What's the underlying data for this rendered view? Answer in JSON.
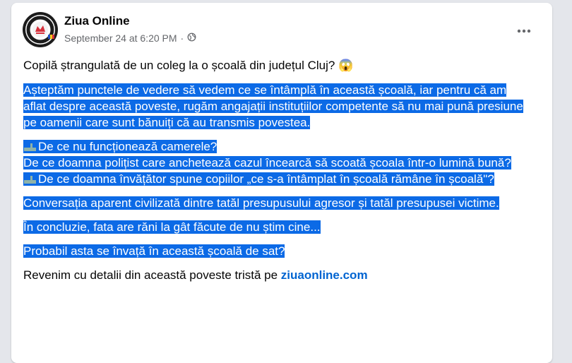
{
  "post": {
    "page_name": "Ziua Online",
    "timestamp": "September 24 at 6:20 PM",
    "separator": "·",
    "audience_icon": "globe-icon",
    "more_icon": "more-options-icon",
    "headline": "Copilă ștrangulată de un coleg la o școală din județul Cluj? 😱",
    "body": {
      "p1": "Așteptăm punctele de vedere să vedem ce se întâmplă în această școală, iar pentru că am aflat despre această poveste, rugăm angajații instituțiilor competente să nu mai pună presiune pe oamenii care sunt bănuiți că au transmis povestea.",
      "q1": "De ce nu funcționează camerele?",
      "q2": "De ce doamna polițist care anchetează cazul încearcă să scoată școala într-o lumină bună?",
      "q3": "De ce doamna învățător spune copiilor „ce s-a întâmplat în școală rămâne în școală\"?",
      "p3": "Conversația aparent civilizată dintre tatăl presupusului agresor și tatăl presupusei victime.",
      "p4": "În concluzie, fata are răni la gât făcute de nu știm cine...",
      "p5": "Probabil asta se învață în această școală de sat?",
      "closing": "Revenim cu detalii din această poveste tristă pe",
      "link": "ziuaonline.com"
    },
    "colors": {
      "selection": "#0c6ae6",
      "link": "#0064d1",
      "meta_text": "#65676b"
    }
  }
}
